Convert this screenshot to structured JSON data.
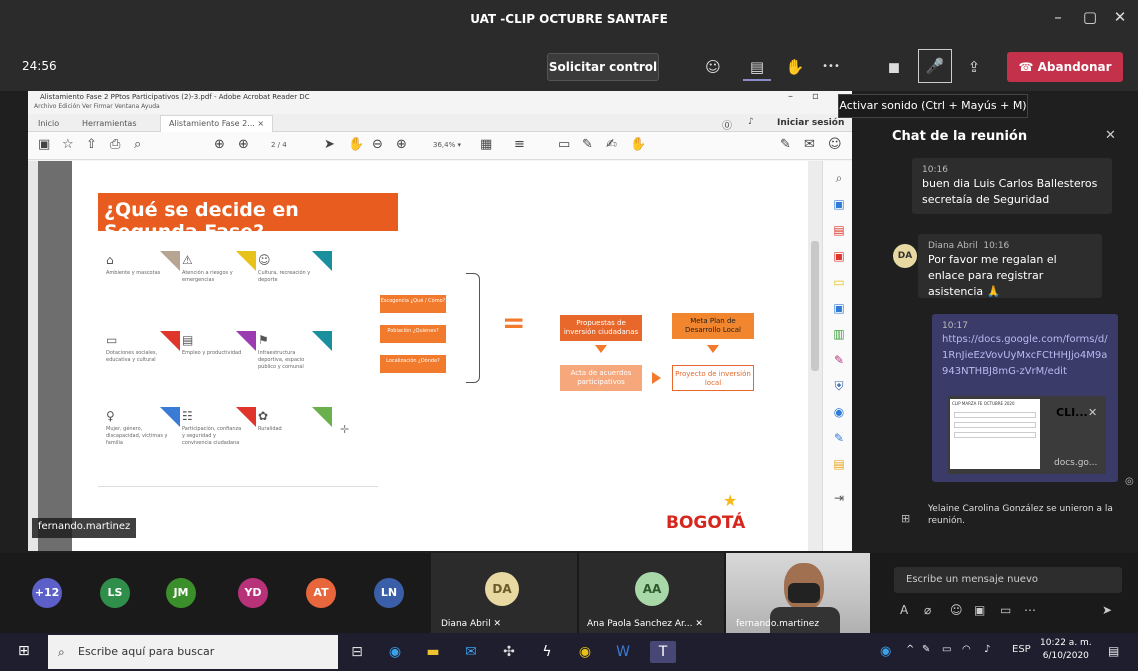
{
  "window": {
    "title": "UAT -CLIP OCTUBRE SANTAFE",
    "minimize": "–",
    "maximize": "▢",
    "close": "✕"
  },
  "toolbar": {
    "timer": "24:56",
    "request_control": "Solicitar control",
    "more": "•••",
    "leave": "Abandonar",
    "mic_tooltip": "Activar sonido (Ctrl + Mayús + M)"
  },
  "acrobat": {
    "title": "Alistamiento Fase 2 PPtos Participativos (2)-3.pdf - Adobe Acrobat Reader DC",
    "menu": "Archivo  Edición  Ver  Firmar  Ventana  Ayuda",
    "tab_home": "Inicio",
    "tab_tools": "Herramientas",
    "tab_doc": "Alistamiento Fase 2... ×",
    "login": "Iniciar sesión",
    "pages": "2 / 4",
    "zoom": "36,4% ▾"
  },
  "slide": {
    "heading": "¿Qué se decide en Segunda Fase?",
    "categories": [
      {
        "label": "Ambiente y mascotas",
        "icon": "⌂"
      },
      {
        "label": "Atención a riesgos y emergencias",
        "icon": "⚠"
      },
      {
        "label": "Cultura, recreación y deporte",
        "icon": "☺"
      },
      {
        "label": "Dotaciones sociales, educativa y cultural",
        "icon": "▭"
      },
      {
        "label": "Empleo y productividad",
        "icon": "▤"
      },
      {
        "label": "Infraestructura deportiva, espacio público y comunal",
        "icon": "⚑"
      },
      {
        "label": "Mujer, género, discapacidad, víctimas y familia",
        "icon": "♀"
      },
      {
        "label": "Participación, confianza y seguridad y convivencia ciudadana",
        "icon": "☷"
      },
      {
        "label": "Ruralidad",
        "icon": "✿"
      }
    ],
    "questions": [
      "Escogencia ¿Qué / Cómo?",
      "Población ¿Quiénes?",
      "Localización ¿Dónde?"
    ],
    "proposals": "Propuestas de inversión ciudadanas",
    "meta": "Meta Plan de Desarrollo Local",
    "acta": "Acta de acuerdos participativos",
    "project": "Proyecto de inversión local",
    "brand": "BOGOTÁ",
    "brand_star": "★"
  },
  "presenter_tag": "fernando.martinez",
  "chat": {
    "title": "Chat de la reunión",
    "messages": [
      {
        "time": "10:16",
        "text": "buen dia Luis Carlos Ballesteros secretaía de Seguridad"
      },
      {
        "author": "Diana Abril",
        "time": "10:16",
        "initials": "DA",
        "text": "Por favor me regalan el enlace para registrar asistencia 🙏"
      },
      {
        "time": "10:17",
        "link": "https://docs.google.com/forms/d/1RnJieEzVovUyMxcFCtHHJjo4M9a943NTHBJ8mG-zVrM/edit"
      }
    ],
    "preview": {
      "title": "CLI...",
      "domain": "docs.go...",
      "img_caption": "CLIP MARZA FE OCTUBRE 2020"
    },
    "system": "Yelaine Carolina González se unieron a la reunión.",
    "compose_placeholder": "Escribe un mensaje nuevo"
  },
  "participants": {
    "extra": "+12",
    "circles": [
      {
        "initials": "LS",
        "color": "#2f8f4a"
      },
      {
        "initials": "JM",
        "color": "#3a8f2b"
      },
      {
        "initials": "YD",
        "color": "#b8327a"
      },
      {
        "initials": "AT",
        "color": "#e8663b"
      },
      {
        "initials": "LN",
        "color": "#3a5fa8"
      }
    ],
    "tiles": [
      {
        "initials": "DA",
        "name": "Diana Abril",
        "color": "#e8d9a3"
      },
      {
        "initials": "AA",
        "name": "Ana Paola Sanchez Ar...",
        "color": "#a8d8a8"
      }
    ],
    "video_name": "fernando.martinez"
  },
  "taskbar": {
    "search_placeholder": "Escribe aquí para buscar",
    "lang": "ESP",
    "time": "10:22 a. m.",
    "date": "6/10/2020"
  }
}
